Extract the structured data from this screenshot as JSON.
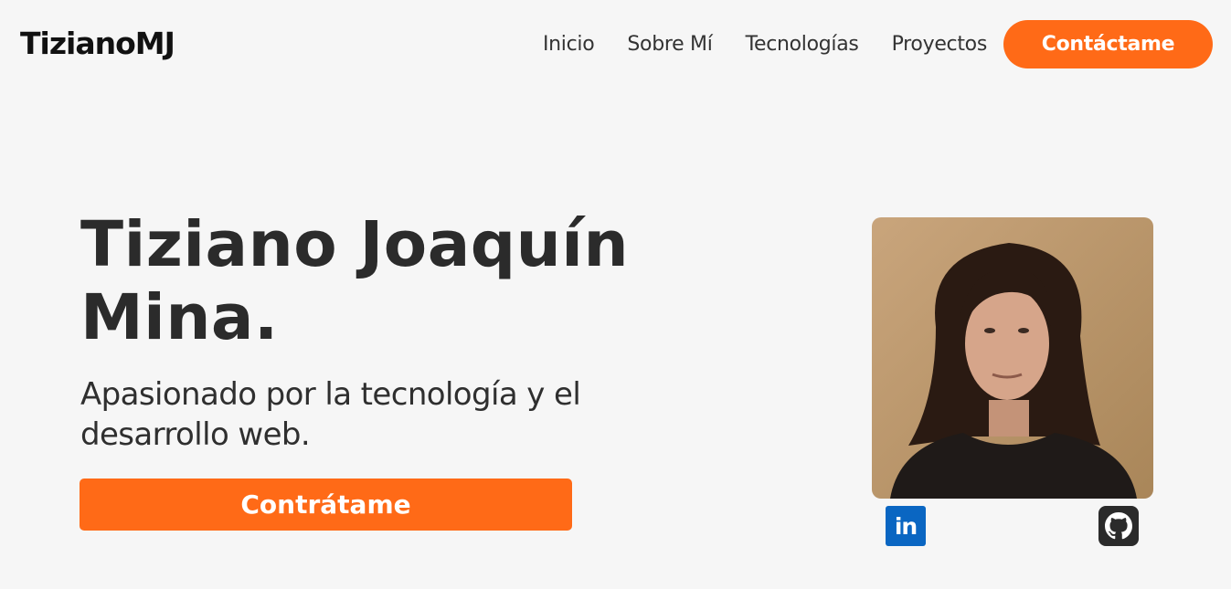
{
  "header": {
    "logo": "TizianoMJ",
    "nav": [
      "Inicio",
      "Sobre Mí",
      "Tecnologías",
      "Proyectos"
    ],
    "contact_label": "Contáctame"
  },
  "hero": {
    "name": "Tiziano Joaquín Mina.",
    "subtitle": "Apasionado por la tecnología y el desarrollo web.",
    "cta_label": "Contrátame"
  },
  "social": {
    "linkedin_icon": "linkedin-icon",
    "github_icon": "github-icon"
  },
  "colors": {
    "accent": "#ff6a17",
    "background": "#f6f6f6",
    "text": "#2a2a2a",
    "linkedin": "#0a66c2"
  }
}
